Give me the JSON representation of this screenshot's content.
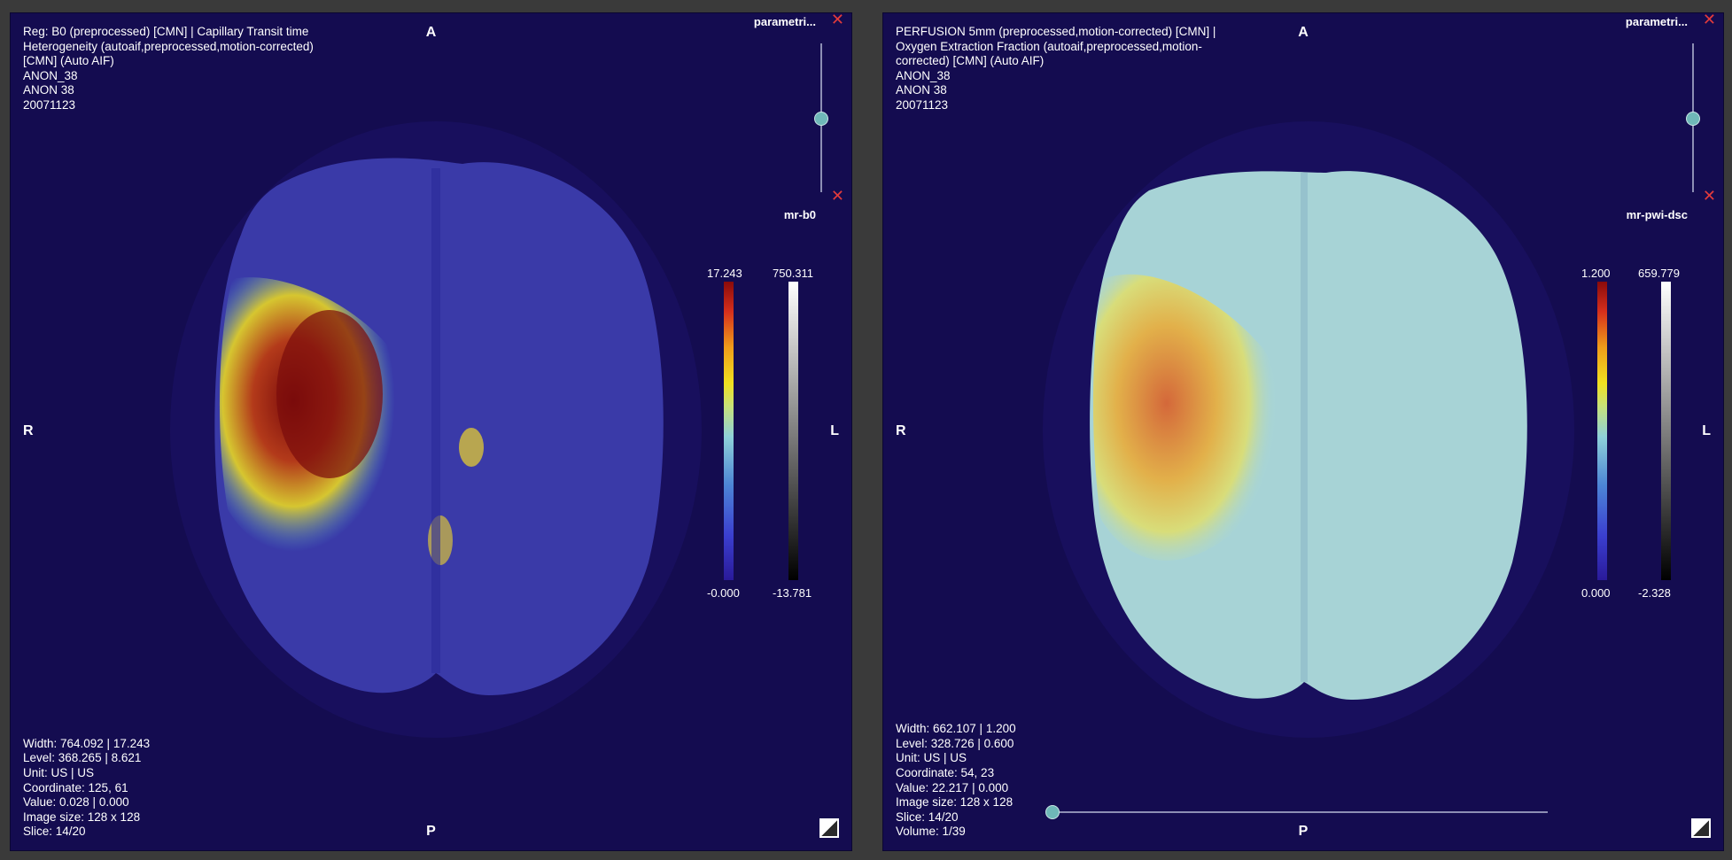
{
  "left": {
    "info_top": "Reg: B0 (preprocessed) [CMN] | Capillary Transit time\nHeterogeneity (autoaif,preprocessed,motion-corrected)\n[CMN] (Auto AIF)\nANON_38\nANON 38\n20071123",
    "info_bottom": "Width: 764.092 | 17.243\nLevel: 368.265 | 8.621\nUnit: US | US\nCoordinate: 125, 61\nValue: 0.028 | 0.000\nImage size: 128 x 128\nSlice: 14/20",
    "orient": {
      "a": "A",
      "p": "P",
      "r": "R",
      "l": "L"
    },
    "label_top": "parametri...",
    "label_mid": "mr-b0",
    "close_icon": "✕",
    "colorbar_param": {
      "max": "17.243",
      "min": "-0.000"
    },
    "colorbar_gray": {
      "max": "750.311",
      "min": "-13.781"
    }
  },
  "right": {
    "info_top": "PERFUSION 5mm (preprocessed,motion-corrected) [CMN] |\nOxygen Extraction Fraction (autoaif,preprocessed,motion-\ncorrected) [CMN] (Auto AIF)\nANON_38\nANON 38\n20071123",
    "info_bottom": "Width: 662.107 | 1.200\nLevel: 328.726 | 0.600\nUnit: US | US\nCoordinate: 54, 23\nValue: 22.217 | 0.000\nImage size: 128 x 128\nSlice: 14/20\nVolume: 1/39",
    "orient": {
      "a": "A",
      "p": "P",
      "r": "R",
      "l": "L"
    },
    "label_top": "parametri...",
    "label_mid": "mr-pwi-dsc",
    "close_icon": "✕",
    "colorbar_param": {
      "max": "1.200",
      "min": "0.000"
    },
    "colorbar_gray": {
      "max": "659.779",
      "min": "-2.328"
    }
  }
}
